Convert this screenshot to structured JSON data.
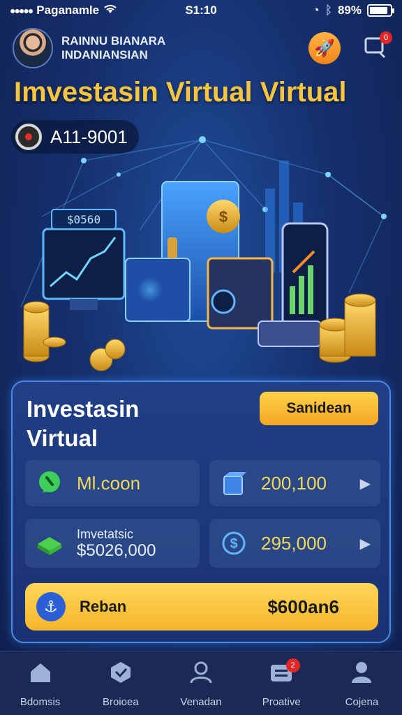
{
  "status_bar": {
    "carrier": "Paganamle",
    "time": "S1:10",
    "battery": "89%",
    "battery_level": 0.89
  },
  "header": {
    "user_name": "Rainnu BIANARA INDANIANSIAN",
    "notification_count": "0"
  },
  "page_title": "Imvestasin Virtual Virtual",
  "account": {
    "id": "A11-9001"
  },
  "illustration": {
    "screen_label": "$0560"
  },
  "card": {
    "title": "Investasin Virtual",
    "button_label": "Sanidean",
    "tiles": [
      {
        "text": "Ml.coon"
      },
      {
        "text": "200,100"
      },
      {
        "label": "Imvetatsic",
        "value": "$5026,000"
      },
      {
        "text": "295,000"
      }
    ],
    "reban": {
      "label": "Reban",
      "amount": "$600an6"
    }
  },
  "bottom_nav": {
    "items": [
      {
        "label": "Bdomsis"
      },
      {
        "label": "Broioea"
      },
      {
        "label": "Venadan"
      },
      {
        "label": "Proative"
      },
      {
        "label": "Cojena"
      }
    ],
    "badge": "2"
  }
}
